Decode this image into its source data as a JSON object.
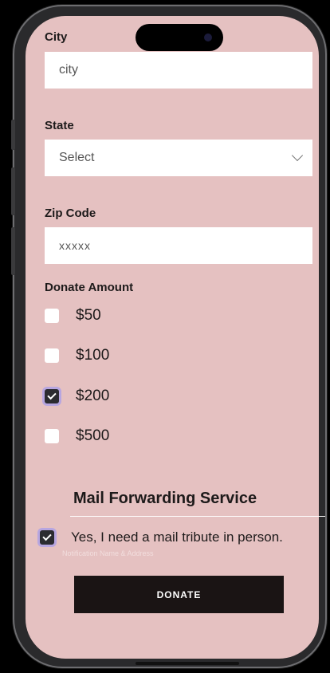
{
  "form": {
    "city_label": "City",
    "city_placeholder": "city",
    "state_label": "State",
    "state_value": "Select",
    "zip_label": "Zip Code",
    "zip_placeholder": "xxxxx",
    "amount_label": "Donate Amount",
    "amounts": [
      {
        "label": "$50",
        "checked": false
      },
      {
        "label": "$100",
        "checked": false
      },
      {
        "label": "$200",
        "checked": true
      },
      {
        "label": "$500",
        "checked": false
      }
    ]
  },
  "mail": {
    "title": "Mail Forwarding Service",
    "option_label": "Yes, I need a mail tribute in person.",
    "option_checked": true,
    "hint": "Notification Name & Address"
  },
  "donate_button": "DONATE",
  "icons": {
    "state_dropdown": "chevron-down-icon",
    "checkbox_checked": "checkmark-icon"
  },
  "colors": {
    "screen_bg": "#e5c1c1",
    "button_bg": "#1a1414",
    "checkbox_checked": "#2b2b30",
    "checkbox_focus_ring": "#b7a6e0"
  }
}
